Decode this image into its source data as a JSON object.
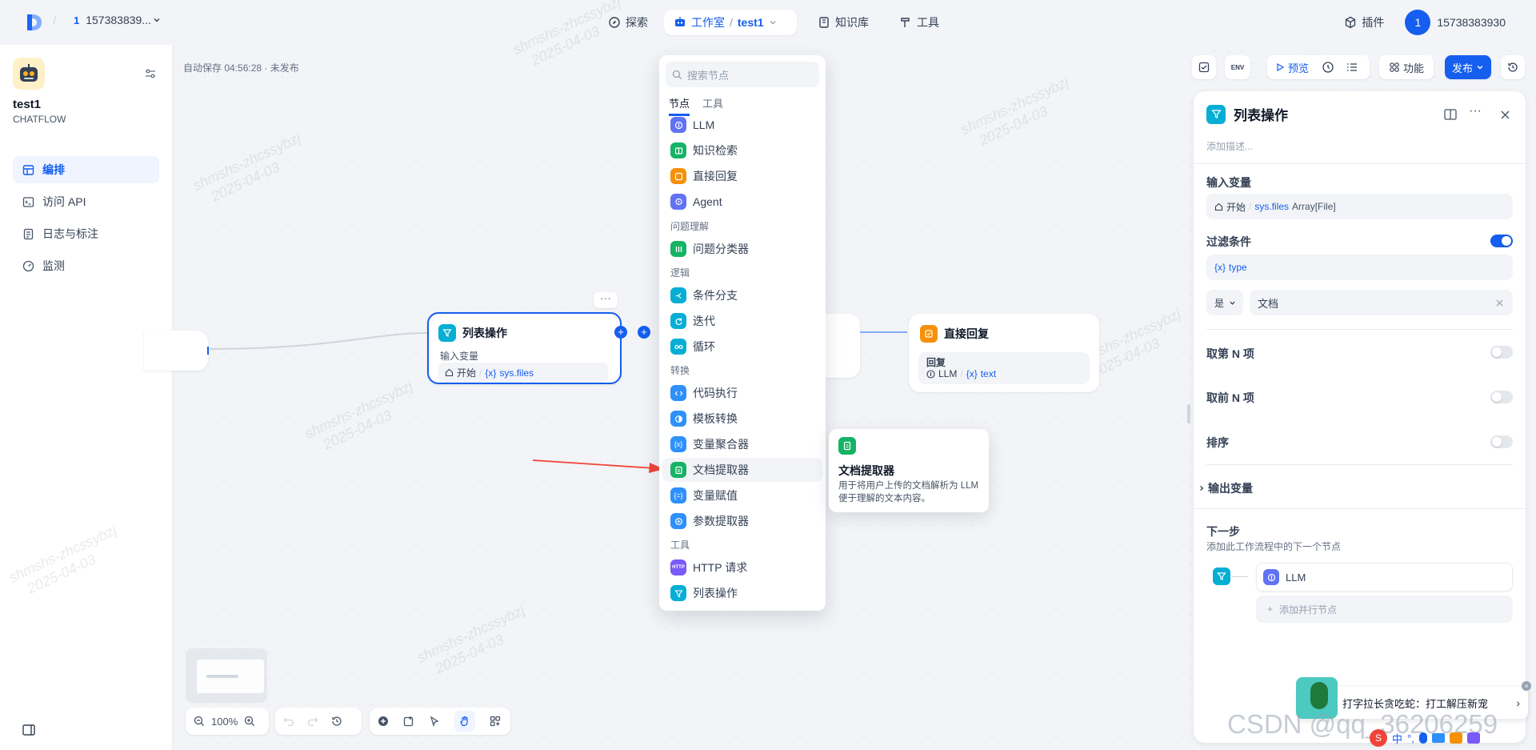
{
  "topbar": {
    "workspace_num": "1",
    "workspace_name": "157383839...",
    "nav_explore": "探索",
    "nav_studio": "工作室",
    "nav_studio_sub": "test1",
    "nav_knowledge": "知识库",
    "nav_tools": "工具",
    "plugins": "插件",
    "avatar_initial": "1",
    "user_name": "15738383930"
  },
  "app": {
    "name": "test1",
    "mode": "CHATFLOW",
    "menu": [
      "编排",
      "访问 API",
      "日志与标注",
      "监测"
    ]
  },
  "canvas": {
    "autosave": "自动保存 04:56:28 · 未发布",
    "list_node": {
      "title": "列表操作",
      "input_label": "输入变量",
      "source": "开始",
      "var": "sys.files"
    },
    "reply_node": {
      "title": "直接回复",
      "label": "回复",
      "source": "LLM",
      "var": "text"
    },
    "zoom": "100%"
  },
  "dropdown": {
    "search_placeholder": "搜索节点",
    "tabs": [
      "节点",
      "工具"
    ],
    "items_top": [
      "LLM",
      "知识检索",
      "直接回复",
      "Agent"
    ],
    "section_qu": "问题理解",
    "items_qu": [
      "问题分类器"
    ],
    "section_logic": "逻辑",
    "items_logic": [
      "条件分支",
      "迭代",
      "循环"
    ],
    "section_transform": "转换",
    "items_transform": [
      "代码执行",
      "模板转换",
      "变量聚合器",
      "文档提取器",
      "变量赋值",
      "参数提取器"
    ],
    "section_tools": "工具",
    "items_tools": [
      "HTTP 请求",
      "列表操作"
    ]
  },
  "tooltip": {
    "title": "文档提取器",
    "desc": "用于将用户上传的文档解析为 LLM 便于理解的文本内容。"
  },
  "header_actions": {
    "preview": "预览",
    "features": "功能",
    "publish": "发布",
    "env": "ENV"
  },
  "panel": {
    "title": "列表操作",
    "desc_placeholder": "添加描述...",
    "input_label": "输入变量",
    "input_source": "开始",
    "input_var": "sys.files",
    "input_type": "Array[File]",
    "filter_label": "过滤条件",
    "filter_var": "type",
    "filter_op": "是",
    "filter_value": "文档",
    "nth_label": "取第 N 项",
    "first_n_label": "取前 N 项",
    "sort_label": "排序",
    "output_label": "输出变量",
    "next_label": "下一步",
    "next_desc": "添加此工作流程中的下一个节点",
    "next_node": "LLM",
    "add_parallel": "添加并行节点"
  },
  "ad": {
    "text": "打字拉长贪吃蛇：打工解压新宠"
  },
  "watermark": {
    "line1": "shmshs-zhcssybzj",
    "line2": "2025-04-03",
    "csdn": "CSDN @qq_36206259"
  },
  "colors": {
    "primary": "#155eef",
    "cyan": "#06aed4",
    "orange": "#f79009",
    "green": "#16b364",
    "indigo": "#6172f3"
  }
}
